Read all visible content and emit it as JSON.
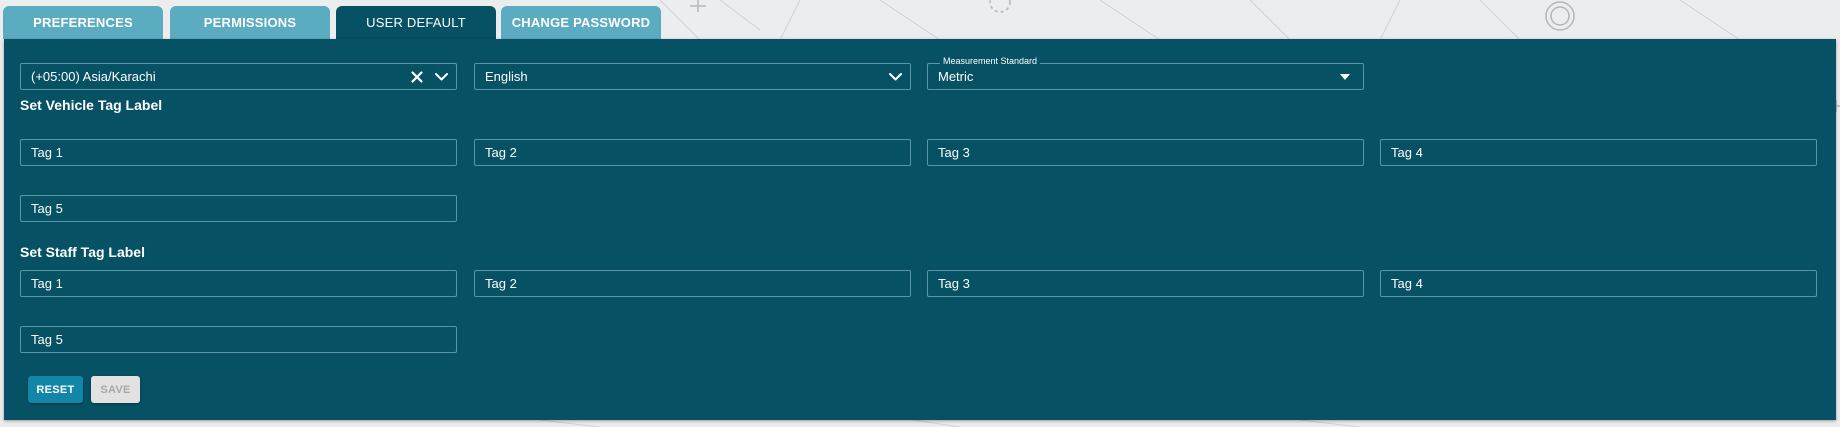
{
  "tabs": [
    {
      "label": "PREFERENCES"
    },
    {
      "label": "PERMISSIONS"
    },
    {
      "label": "USER DEFAULT"
    },
    {
      "label": "CHANGE PASSWORD"
    }
  ],
  "active_tab": "USER DEFAULT",
  "timezone": {
    "value": "(+05:00) Asia/Karachi"
  },
  "language": {
    "value": "English"
  },
  "measurement": {
    "label": "Measurement Standard",
    "value": "Metric"
  },
  "vehicle_tags": {
    "title": "Set Vehicle Tag Label",
    "values": [
      "Tag 1",
      "Tag 2",
      "Tag 3",
      "Tag 4",
      "Tag 5"
    ]
  },
  "staff_tags": {
    "title": "Set Staff Tag Label",
    "values": [
      "Tag 1",
      "Tag 2",
      "Tag 3",
      "Tag 4",
      "Tag 5"
    ]
  },
  "buttons": {
    "reset": "RESET",
    "save": "SAVE"
  },
  "colors": {
    "panel": "#065163",
    "tab": "#5bacc0",
    "reset": "#1286a8",
    "field_border": "#5796a6"
  }
}
